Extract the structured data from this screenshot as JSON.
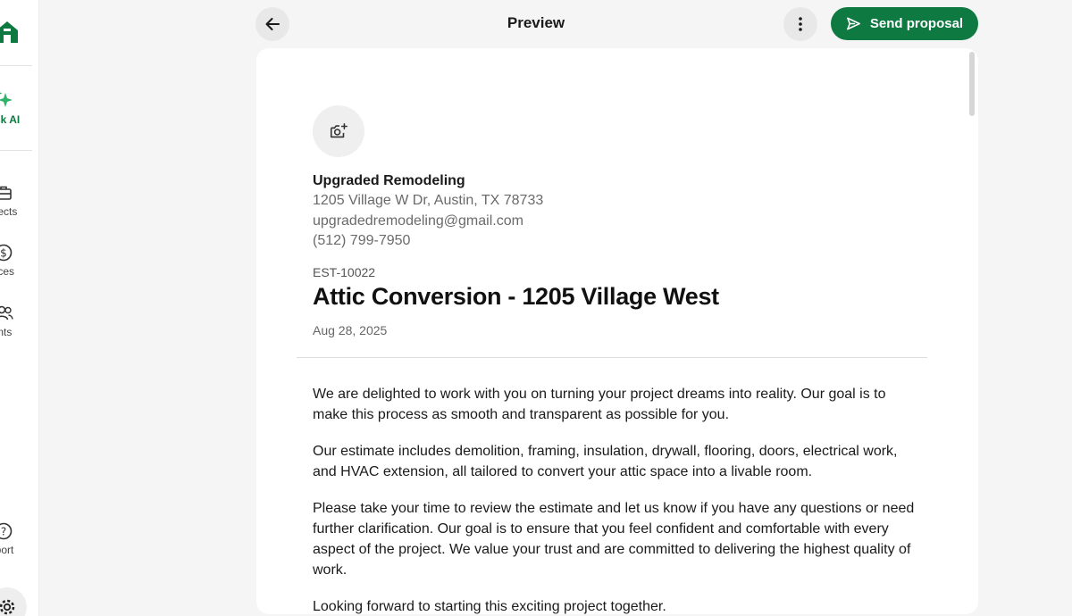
{
  "sidebar": {
    "items": [
      {
        "label": "sk AI",
        "icon": "sparkle-icon"
      },
      {
        "label": "ojects",
        "icon": "toolbox-icon"
      },
      {
        "label": "oices",
        "icon": "dollar-icon"
      },
      {
        "label": "ients",
        "icon": "users-icon"
      },
      {
        "label": "pport",
        "icon": "help-icon"
      }
    ],
    "brand_color": "#0e7a42",
    "ai_color": "#2fb36b"
  },
  "topbar": {
    "title": "Preview",
    "send_label": "Send proposal",
    "send_color": "#0e7a42"
  },
  "company": {
    "name": "Upgraded Remodeling",
    "address": "1205 Village W Dr, Austin, TX 78733",
    "email": "upgradedremodeling@gmail.com",
    "phone": "(512) 799-7950"
  },
  "estimate": {
    "number": "EST-10022",
    "title": "Attic Conversion - 1205 Village West",
    "date": "Aug 28, 2025"
  },
  "body": {
    "p1": "We are delighted to work with you on turning your project dreams into reality. Our goal is to make this process as smooth and transparent as possible for you.",
    "p2": "Our estimate includes demolition, framing, insulation, drywall, flooring, doors, electrical work, and HVAC extension, all tailored to convert your attic space into a livable room.",
    "p3": "Please take your time to review the estimate and let us know if you have any questions or need further clarification. Our goal is to ensure that you feel confident and comfortable with every aspect of the project. We value your trust and are committed to delivering the highest quality of work.",
    "p4": "Looking forward to starting this exciting project together."
  }
}
